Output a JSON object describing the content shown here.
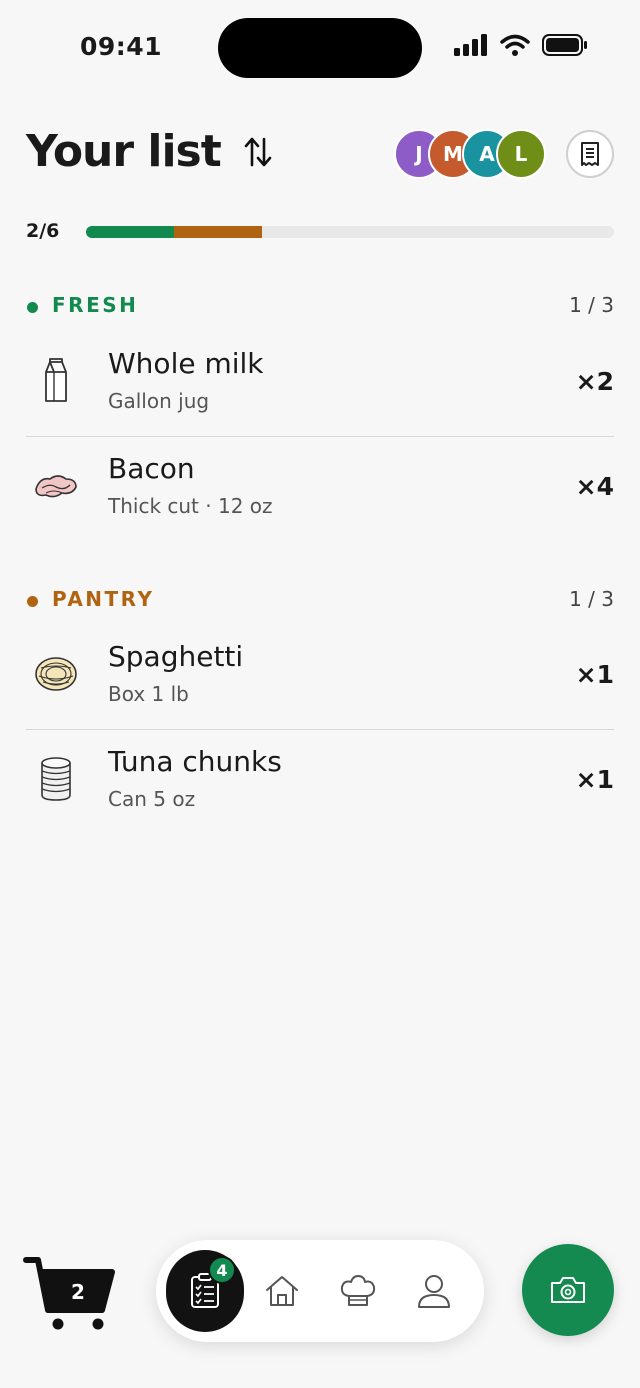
{
  "status_bar": {
    "time": "09:41"
  },
  "header": {
    "title": "Your list",
    "collaborators": [
      {
        "initial": "J",
        "color": "#8e5cc7"
      },
      {
        "initial": "M",
        "color": "#c55a2c"
      },
      {
        "initial": "A",
        "color": "#1a93a0"
      },
      {
        "initial": "L",
        "color": "#6f8e17"
      }
    ]
  },
  "progress": {
    "label": "2/6",
    "fresh_fraction": 0.1667,
    "pantry_fraction": 0.1667,
    "fresh_color": "#128a4f",
    "pantry_color": "#b06411"
  },
  "sections": [
    {
      "title": "FRESH",
      "count": "1 / 3",
      "color": "#128a4f",
      "items": [
        {
          "name": "Whole milk",
          "detail": "Gallon jug",
          "qty": "×2",
          "icon": "milk-carton-icon"
        },
        {
          "name": "Bacon",
          "detail": "Thick cut · 12 oz",
          "qty": "×4",
          "icon": "bacon-icon"
        }
      ]
    },
    {
      "title": "PANTRY",
      "count": "1 / 3",
      "color": "#b06411",
      "items": [
        {
          "name": "Spaghetti",
          "detail": "Box 1 lb",
          "qty": "×1",
          "icon": "spaghetti-icon"
        },
        {
          "name": "Tuna chunks",
          "detail": "Can 5 oz",
          "qty": "×1",
          "icon": "tin-can-icon"
        }
      ]
    }
  ],
  "bottom_bar": {
    "cart_count": "2",
    "list_badge": "4",
    "accent": "#148a50"
  }
}
